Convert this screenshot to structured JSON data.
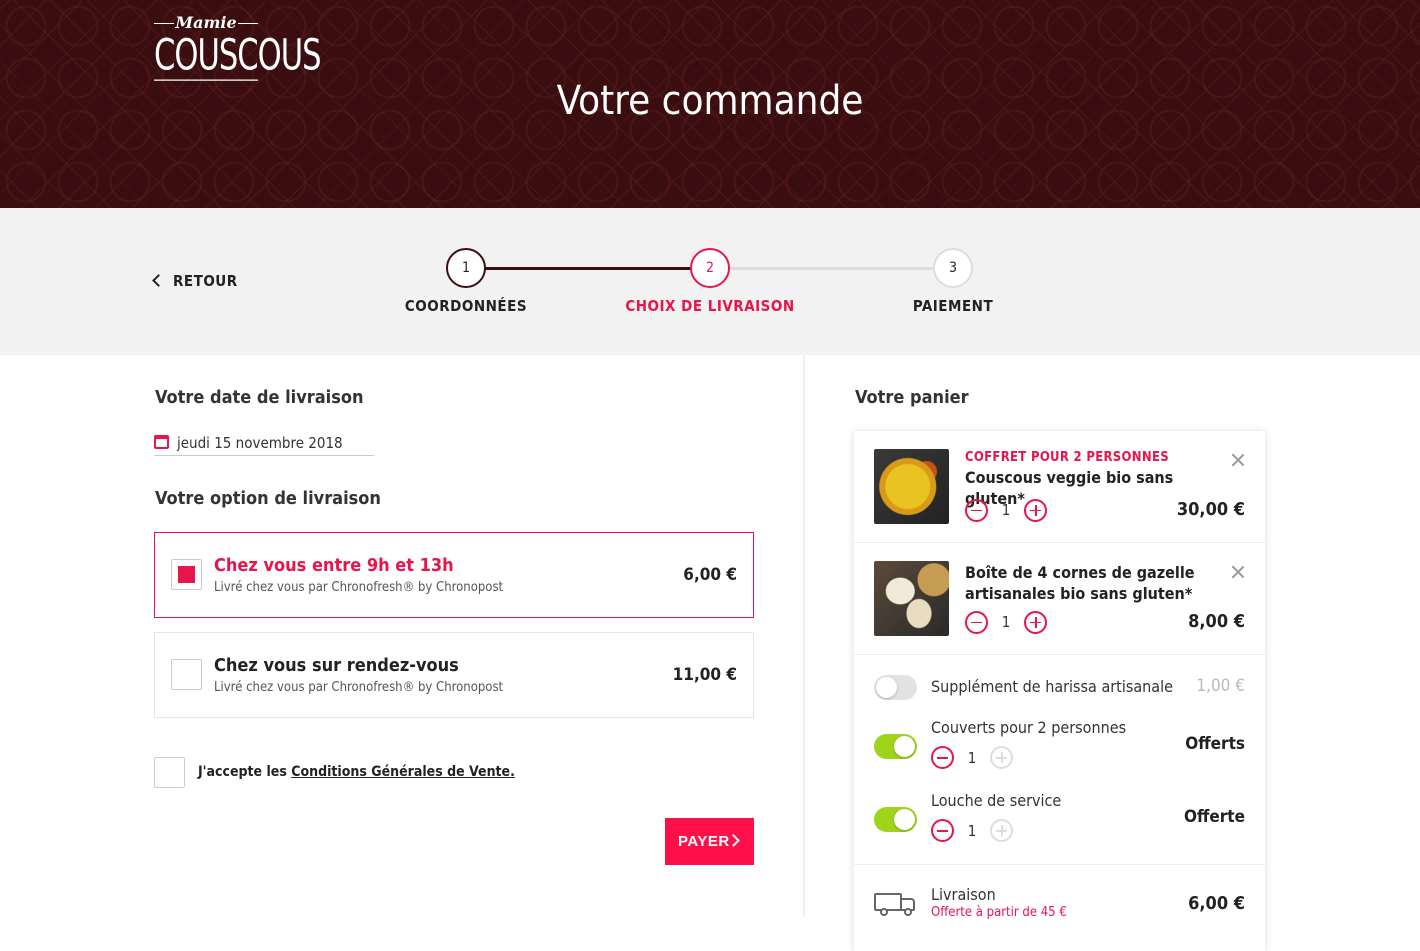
{
  "header": {
    "logo_top": "Mamie",
    "logo_main": "COUSCOUS",
    "title": "Votre commande"
  },
  "nav": {
    "back_label": "RETOUR"
  },
  "steps": [
    {
      "number": "1",
      "label": "COORDONNÉES",
      "state": "done"
    },
    {
      "number": "2",
      "label": "CHOIX DE LIVRAISON",
      "state": "active"
    },
    {
      "number": "3",
      "label": "PAIEMENT",
      "state": "todo"
    }
  ],
  "delivery": {
    "date_heading": "Votre date de livraison",
    "date_value": "jeudi 15 novembre 2018",
    "option_heading": "Votre option de livraison",
    "options": [
      {
        "title": "Chez vous entre 9h et 13h",
        "subtitle": "Livré chez vous par Chronofresh® by Chronopost",
        "price": "6,00 €",
        "selected": true
      },
      {
        "title": "Chez vous sur rendez-vous",
        "subtitle": "Livré chez vous par Chronofresh® by Chronopost",
        "price": "11,00 €",
        "selected": false
      }
    ],
    "cgv_prefix": "J'accepte les ",
    "cgv_link": "Conditions Générales de Vente.",
    "pay_label": "PAYER"
  },
  "cart": {
    "heading": "Votre panier",
    "items": [
      {
        "tag": "COFFRET POUR 2 PERSONNES",
        "name": "Couscous veggie bio sans gluten*",
        "qty": "1",
        "price": "30,00 €"
      },
      {
        "tag": "",
        "name": "Boîte de 4 cornes de gazelle artisanales bio sans gluten*",
        "qty": "1",
        "price": "8,00 €"
      }
    ],
    "extras": [
      {
        "label": "Supplément de harissa artisanale",
        "price": "1,00 €",
        "enabled": false
      },
      {
        "label": "Couverts pour 2 personnes",
        "qty": "1",
        "price": "Offerts",
        "enabled": true
      },
      {
        "label": "Louche de service",
        "qty": "1",
        "price": "Offerte",
        "enabled": true
      }
    ],
    "shipping_label": "Livraison",
    "shipping_note": "Offerte à partir de 45 €",
    "shipping_price": "6,00 €"
  },
  "colors": {
    "accent": "#e8144c",
    "pay_button": "#ff1049",
    "toggle_on": "#9fd41a",
    "header_bg": "#3a0e10"
  }
}
